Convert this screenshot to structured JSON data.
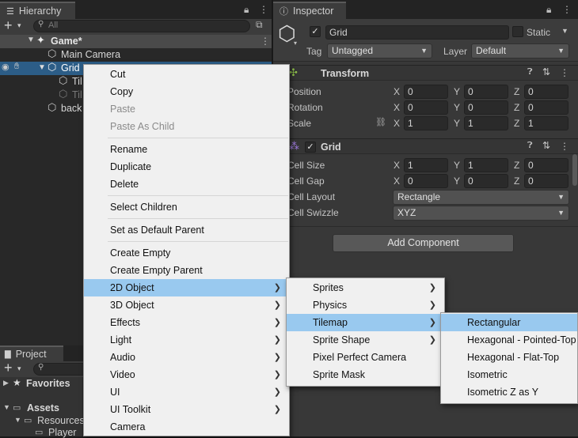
{
  "hierarchy": {
    "tab": "Hierarchy",
    "search_placeholder": "All",
    "scene": "Game*",
    "items": [
      "Main Camera",
      "Grid",
      "Til",
      "Til",
      "back"
    ]
  },
  "inspector": {
    "tab": "Inspector",
    "object_name": "Grid",
    "static_label": "Static",
    "tag_label": "Tag",
    "tag_value": "Untagged",
    "layer_label": "Layer",
    "layer_value": "Default",
    "transform": {
      "title": "Transform",
      "rows": [
        {
          "label": "Position",
          "x": "0",
          "y": "0",
          "z": "0"
        },
        {
          "label": "Rotation",
          "x": "0",
          "y": "0",
          "z": "0"
        },
        {
          "label": "Scale",
          "x": "1",
          "y": "1",
          "z": "1"
        }
      ]
    },
    "grid": {
      "title": "Grid",
      "cell_size": {
        "label": "Cell Size",
        "x": "1",
        "y": "1",
        "z": "0"
      },
      "cell_gap": {
        "label": "Cell Gap",
        "x": "0",
        "y": "0",
        "z": "0"
      },
      "cell_layout": {
        "label": "Cell Layout",
        "value": "Rectangle"
      },
      "cell_swizzle": {
        "label": "Cell Swizzle",
        "value": "XYZ"
      }
    },
    "axes": {
      "x": "X",
      "y": "Y",
      "z": "Z"
    },
    "add_component": "Add Component"
  },
  "project": {
    "tab": "Project",
    "favorites": "Favorites",
    "assets": "Assets",
    "resources": "Resources",
    "player": "Player"
  },
  "context_menu": {
    "g1": [
      "Cut",
      "Copy",
      "Paste",
      "Paste As Child"
    ],
    "g2": [
      "Rename",
      "Duplicate",
      "Delete"
    ],
    "g3": [
      "Select Children"
    ],
    "g4": [
      "Set as Default Parent"
    ],
    "g5": [
      "Create Empty",
      "Create Empty Parent",
      "2D Object",
      "3D Object",
      "Effects",
      "Light",
      "Audio",
      "Video",
      "UI",
      "UI Toolkit",
      "Camera"
    ]
  },
  "submenu_2d": [
    "Sprites",
    "Physics",
    "Tilemap",
    "Sprite Shape",
    "Pixel Perfect Camera",
    "Sprite Mask"
  ],
  "submenu_tilemap": [
    "Rectangular",
    "Hexagonal - Pointed-Top",
    "Hexagonal - Flat-Top",
    "Isometric",
    "Isometric Z as Y"
  ]
}
